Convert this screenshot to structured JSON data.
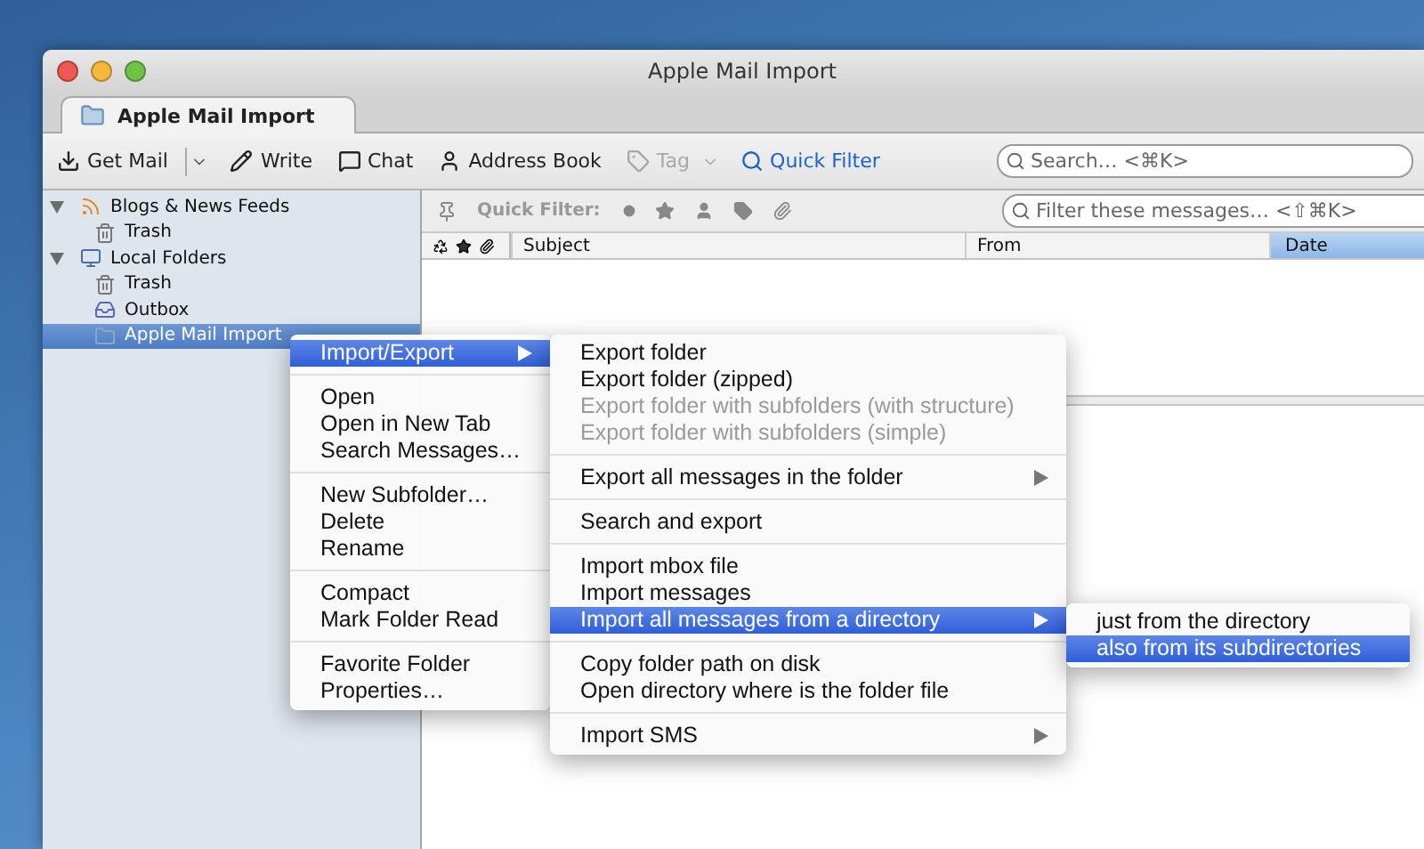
{
  "window": {
    "title": "Apple Mail Import"
  },
  "tab": {
    "label": "Apple Mail Import",
    "selected": true
  },
  "toolbar": [
    {
      "label": "Get Mail",
      "kind": "get-mail",
      "dropdown": true,
      "disabled": false
    },
    {
      "label": "Write",
      "kind": "write",
      "dropdown": false,
      "disabled": false
    },
    {
      "label": "Chat",
      "kind": "chat",
      "dropdown": false,
      "disabled": false
    },
    {
      "label": "Address Book",
      "kind": "address-book",
      "dropdown": false,
      "disabled": false
    },
    {
      "label": "Tag",
      "kind": "tag",
      "dropdown": true,
      "disabled": true
    },
    {
      "label": "Quick Filter",
      "kind": "quick-filter",
      "dropdown": false,
      "disabled": false
    }
  ],
  "search": {
    "placeholder": "Search… <⌘K>"
  },
  "folders": [
    {
      "label": "Blogs & News Feeds",
      "kind": "feeds",
      "expanded": true,
      "selected": false,
      "children": [
        {
          "label": "Trash",
          "kind": "trash",
          "selected": false
        }
      ]
    },
    {
      "label": "Local Folders",
      "kind": "local",
      "expanded": true,
      "selected": false,
      "children": [
        {
          "label": "Trash",
          "kind": "trash",
          "selected": false
        },
        {
          "label": "Outbox",
          "kind": "outbox",
          "selected": false
        },
        {
          "label": "Apple Mail Import",
          "kind": "folder",
          "selected": true
        }
      ]
    }
  ],
  "quick_filter": {
    "label": "Quick Filter:",
    "placeholder": "Filter these messages… <⇧⌘K>"
  },
  "columns": [
    {
      "label": "Subject",
      "selected": false
    },
    {
      "label": "From",
      "selected": false
    },
    {
      "label": "Date",
      "selected": true
    }
  ],
  "context_menu": [
    {
      "items": [
        {
          "label": "Import/Export",
          "selected": true,
          "disabled": false,
          "submenu": true
        }
      ]
    },
    {
      "items": [
        {
          "label": "Open",
          "selected": false,
          "disabled": false,
          "submenu": false
        },
        {
          "label": "Open in New Tab",
          "selected": false,
          "disabled": false,
          "submenu": false
        },
        {
          "label": "Search Messages…",
          "selected": false,
          "disabled": false,
          "submenu": false
        }
      ]
    },
    {
      "items": [
        {
          "label": "New Subfolder…",
          "selected": false,
          "disabled": false,
          "submenu": false
        },
        {
          "label": "Delete",
          "selected": false,
          "disabled": false,
          "submenu": false
        },
        {
          "label": "Rename",
          "selected": false,
          "disabled": false,
          "submenu": false
        }
      ]
    },
    {
      "items": [
        {
          "label": "Compact",
          "selected": false,
          "disabled": false,
          "submenu": false
        },
        {
          "label": "Mark Folder Read",
          "selected": false,
          "disabled": false,
          "submenu": false
        }
      ]
    },
    {
      "items": [
        {
          "label": "Favorite Folder",
          "selected": false,
          "disabled": false,
          "submenu": false
        },
        {
          "label": "Properties…",
          "selected": false,
          "disabled": false,
          "submenu": false
        }
      ]
    }
  ],
  "import_export_menu": [
    {
      "items": [
        {
          "label": "Export folder",
          "selected": false,
          "disabled": false,
          "submenu": false
        },
        {
          "label": "Export folder (zipped)",
          "selected": false,
          "disabled": false,
          "submenu": false
        },
        {
          "label": "Export folder with subfolders (with structure)",
          "selected": false,
          "disabled": true,
          "submenu": false
        },
        {
          "label": "Export folder with subfolders (simple)",
          "selected": false,
          "disabled": true,
          "submenu": false
        }
      ]
    },
    {
      "items": [
        {
          "label": "Export all messages in the folder",
          "selected": false,
          "disabled": false,
          "submenu": true
        }
      ]
    },
    {
      "items": [
        {
          "label": "Search and export",
          "selected": false,
          "disabled": false,
          "submenu": false
        }
      ]
    },
    {
      "items": [
        {
          "label": "Import mbox file",
          "selected": false,
          "disabled": false,
          "submenu": false
        },
        {
          "label": "Import messages",
          "selected": false,
          "disabled": false,
          "submenu": false
        },
        {
          "label": "Import all messages from a directory",
          "selected": true,
          "disabled": false,
          "submenu": true
        }
      ]
    },
    {
      "items": [
        {
          "label": "Copy folder path on disk",
          "selected": false,
          "disabled": false,
          "submenu": false
        },
        {
          "label": "Open directory where is the folder file",
          "selected": false,
          "disabled": false,
          "submenu": false
        }
      ]
    },
    {
      "items": [
        {
          "label": "Import SMS",
          "selected": false,
          "disabled": false,
          "submenu": true
        }
      ]
    }
  ],
  "directory_menu": [
    {
      "items": [
        {
          "label": "just from the directory",
          "selected": false,
          "disabled": false,
          "submenu": false
        },
        {
          "label": "also from its subdirectories",
          "selected": true,
          "disabled": false,
          "submenu": false
        }
      ]
    }
  ]
}
